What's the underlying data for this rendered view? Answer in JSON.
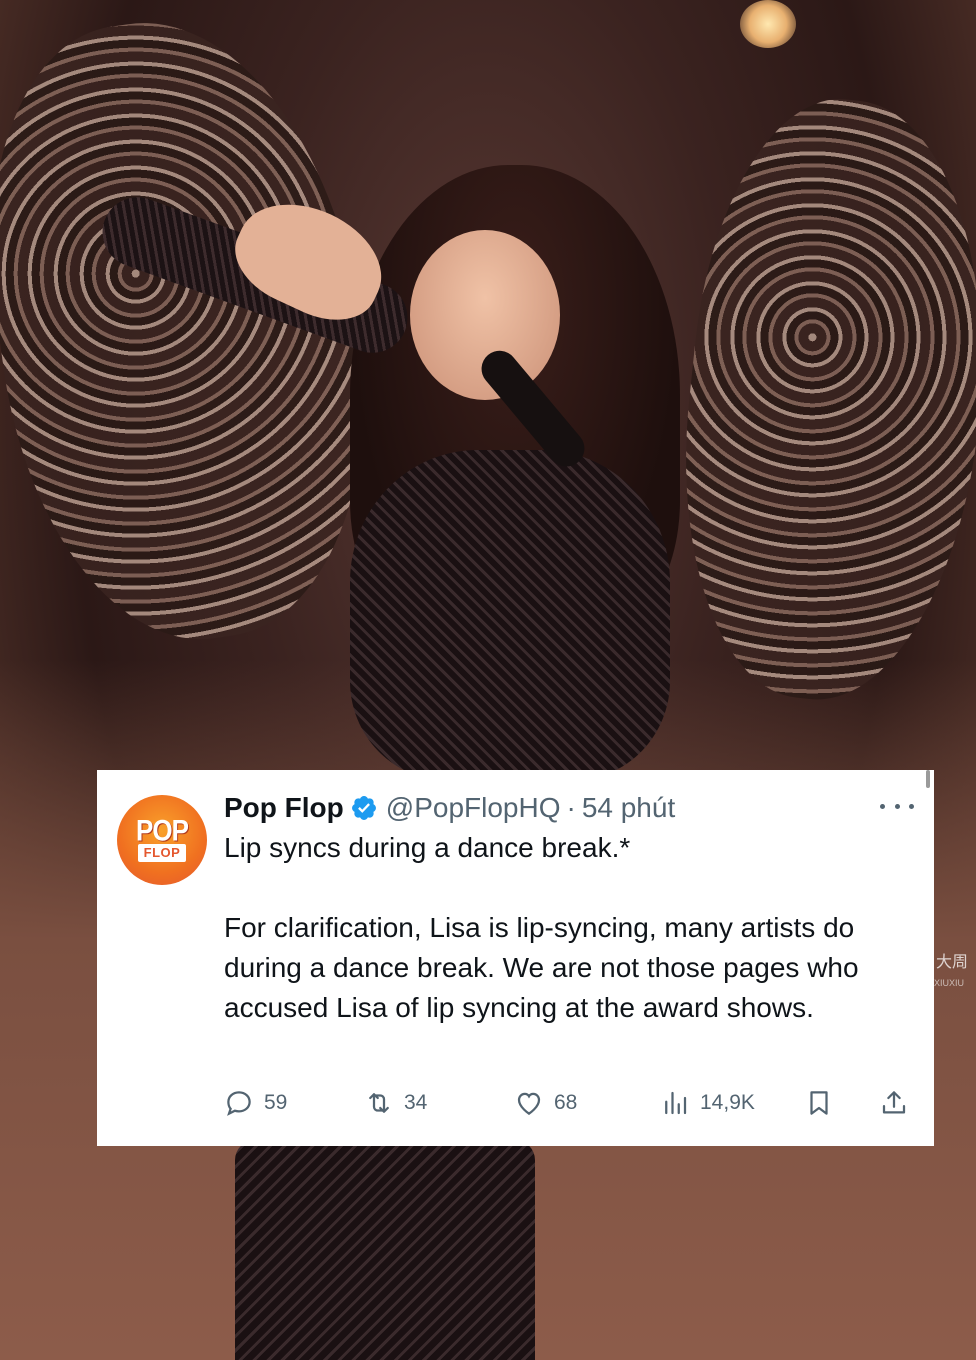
{
  "background": {
    "watermark": "大周",
    "watermark_sub": "XIUXIU"
  },
  "tweet": {
    "avatar": {
      "logo_top": "POP",
      "logo_bottom": "FLOP"
    },
    "display_name": "Pop Flop",
    "verified_icon": "verified-badge-icon",
    "handle": "@PopFlopHQ",
    "separator": "·",
    "time": "54 phút",
    "more_icon": "more-options-icon",
    "text_line1": "Lip syncs during a dance break.*",
    "text_line2": "For clarification, Lisa is lip-syncing, many artists do during a dance break. We are not those pages who accused Lisa of lip syncing at the award shows.",
    "actions": {
      "replies": "59",
      "retweets": "34",
      "likes": "68",
      "views": "14,9K"
    },
    "colors": {
      "text": "#0f1419",
      "muted": "#536471",
      "verified": "#1d9bf0",
      "avatar_orange": "#f07020"
    }
  }
}
